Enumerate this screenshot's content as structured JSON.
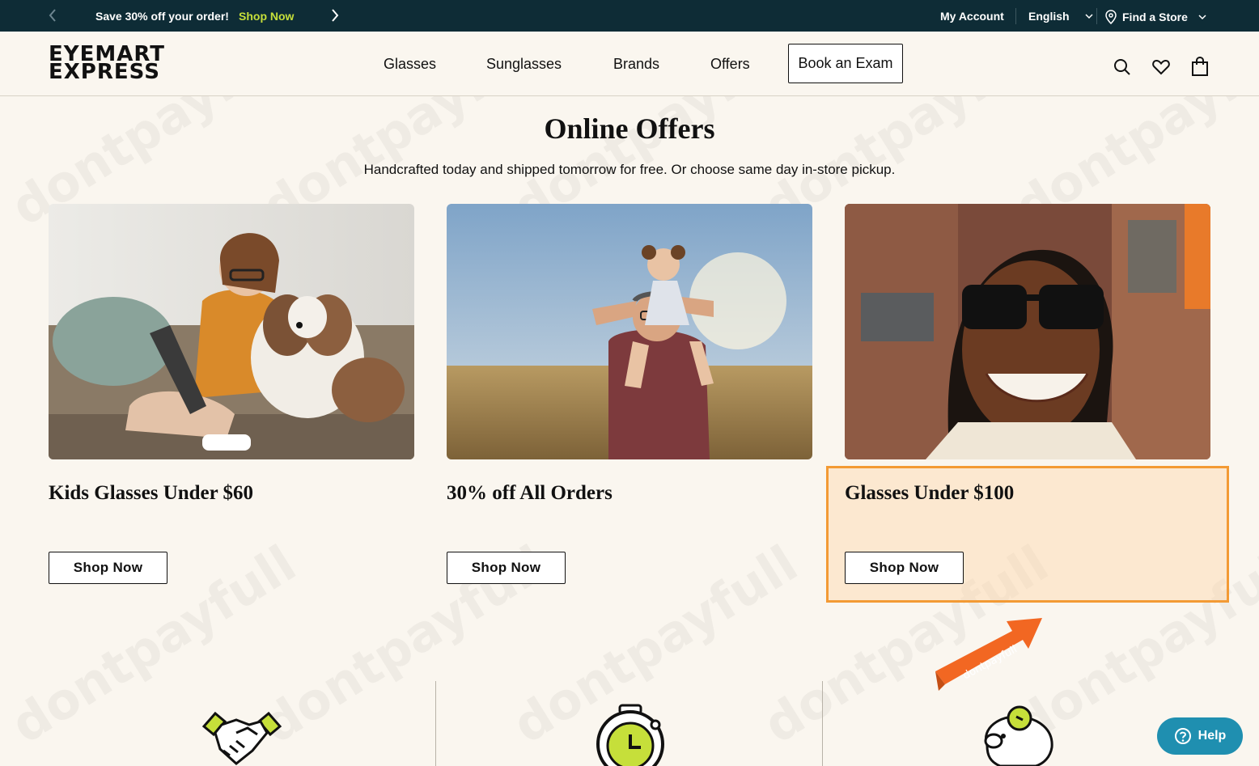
{
  "promo": {
    "text": "Save 30% off your order!",
    "link": "Shop Now"
  },
  "utility": {
    "account": "My Account",
    "language": "English",
    "store": "Find a Store"
  },
  "logo": {
    "line1": "EYEMART",
    "line2": "EXPRESS"
  },
  "nav": {
    "items": [
      "Glasses",
      "Sunglasses",
      "Brands",
      "Offers"
    ],
    "book": "Book an Exam"
  },
  "page": {
    "title": "Online Offers",
    "subtitle": "Handcrafted today and shipped tomorrow for free. Or choose same day in-store pickup."
  },
  "offers": [
    {
      "title": "Kids Glasses Under $60",
      "button": "Shop Now"
    },
    {
      "title": "30% off All Orders",
      "button": "Shop Now"
    },
    {
      "title": "Glasses Under $100",
      "button": "Shop Now"
    }
  ],
  "help": {
    "label": "Help"
  },
  "watermark": {
    "text": "dontpayfull"
  },
  "colors": {
    "promo_bg": "#0e2c36",
    "accent_lime": "#c6df3a",
    "page_bg": "#faf6ef",
    "highlight": "#f39a34",
    "help_bg": "#1f8fb0"
  }
}
